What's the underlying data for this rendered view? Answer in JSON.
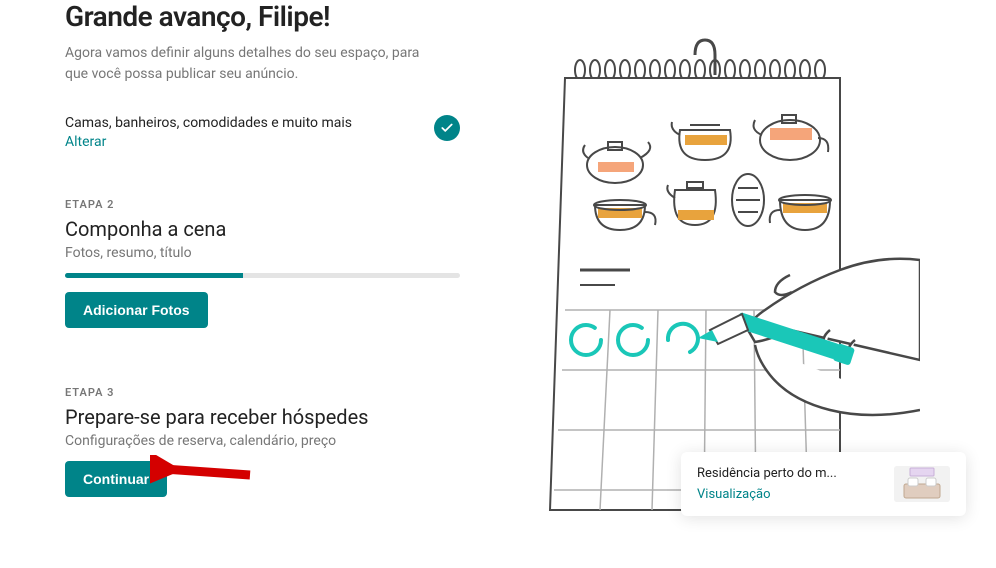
{
  "header": {
    "title": "Grande avanço, Filipe!",
    "subtitle": "Agora vamos definir alguns detalhes do seu espaço, para que você possa publicar seu anúncio."
  },
  "step1": {
    "description": "Camas, banheiros, comodidades e muito mais",
    "edit_label": "Alterar"
  },
  "step2": {
    "label": "ETAPA 2",
    "title": "Componha a cena",
    "description": "Fotos, resumo, título",
    "button_label": "Adicionar Fotos",
    "progress_percent": 45
  },
  "step3": {
    "label": "ETAPA 3",
    "title": "Prepare-se para receber hóspedes",
    "description": "Configurações de reserva, calendário, preço",
    "button_label": "Continuar"
  },
  "preview": {
    "title": "Residência perto do m...",
    "link_label": "Visualização"
  },
  "colors": {
    "teal": "#008489",
    "gray_text": "#767676"
  }
}
